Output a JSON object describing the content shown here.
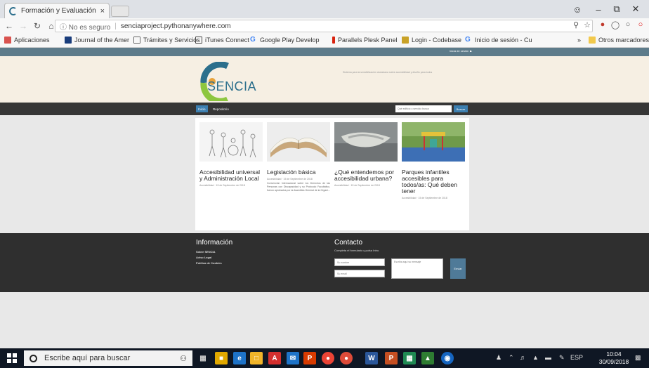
{
  "browser": {
    "tab_title": "Formación y Evaluación d",
    "tab_close": "×",
    "security": "ⓘ No es seguro",
    "url": "senciaproject.pythonanywhere.com",
    "bookmarks": [
      "Aplicaciones",
      "Journal of the Amer",
      "Trámites y Servicios",
      "iTunes Connect",
      "Google Play Develop",
      "Parallels Plesk Panel",
      "Login - Codebase",
      "Inicio de sesión - Cu",
      "»",
      "Otros marcadores"
    ]
  },
  "site": {
    "login_link": "Inicia de sesión",
    "logo_text": "SENCIA",
    "tagline": "Sistema para la sensibilización ciudadana sobre accesibilidad y diseño para todos",
    "nav": [
      "Inicio",
      "Repositorio"
    ],
    "search_placeholder": "Qué edificio u servicio busca",
    "search_button": "Buscar",
    "cards": [
      {
        "title": "Accesibilidad universal y Administración Local",
        "meta": "Accesibilidad · 15 de Septiembre de 2018"
      },
      {
        "title": "Legislación básica",
        "meta": "Accesibilidad · 15 de Septiembre de 2018",
        "excerpt": "Convención Internacional sobre los Derechos de las Personas con Discapacidad y su Protocolo Facultativo, fueron aprobados por la Asamblea General de la Organi..."
      },
      {
        "title": "¿Qué entendemos por accesibilidad urbana?",
        "meta": "Accesibilidad · 15 de Septiembre de 2018"
      },
      {
        "title": "Parques infantiles accesibles para todos/as: Qué deben tener",
        "meta": "Accesibilidad · 15 de Septiembre de 2018"
      }
    ],
    "footer": {
      "info_heading": "Información",
      "links": [
        "Sobre SENCIA",
        "Aviso Legal",
        "Política de Cookies"
      ],
      "contact_heading": "Contacto",
      "contact_note": "Completa el formulario y pulsa Intro.",
      "name_placeholder": "Su nombre",
      "email_placeholder": "Su email",
      "message_placeholder": "Escriba aquí su mensaje",
      "send_button": "Enviar"
    }
  },
  "taskbar": {
    "search_placeholder": "Escribe aquí para buscar",
    "lang": "ESP",
    "time": "10:04",
    "date": "30/09/2018"
  }
}
